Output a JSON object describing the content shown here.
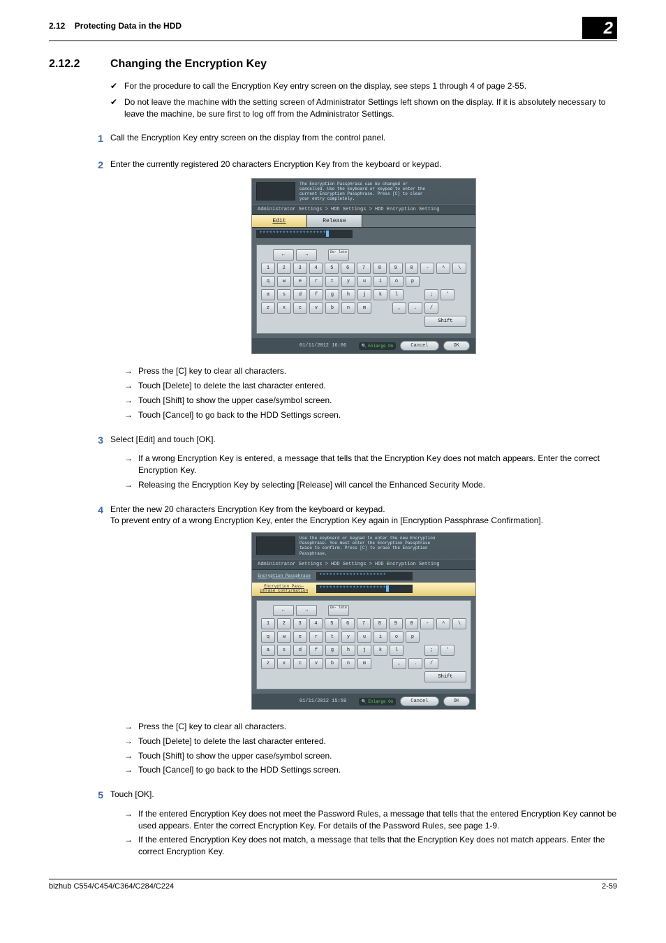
{
  "header": {
    "section_ref": "2.12",
    "section_name": "Protecting Data in the HDD",
    "chapter_badge": "2"
  },
  "section": {
    "number": "2.12.2",
    "title": "Changing the Encryption Key"
  },
  "prereqs": [
    "For the procedure to call the Encryption Key entry screen on the display, see steps 1 through 4 of page 2-55.",
    "Do not leave the machine with the setting screen of Administrator Settings left shown on the display. If it is absolutely necessary to leave the machine, be sure first to log off from the Administrator Settings."
  ],
  "steps": {
    "s1": {
      "num": "1",
      "text": "Call the Encryption Key entry screen on the display from the control panel."
    },
    "s2": {
      "num": "2",
      "text": "Enter the currently registered 20 characters Encryption Key from the keyboard or keypad.",
      "arrows": [
        "Press the [C] key to clear all characters.",
        "Touch [Delete] to delete the last character entered.",
        "Touch [Shift] to show the upper case/symbol screen.",
        "Touch [Cancel] to go back to the HDD Settings screen."
      ]
    },
    "s3": {
      "num": "3",
      "text": "Select [Edit] and touch [OK].",
      "arrows": [
        "If a wrong Encryption Key is entered, a message that tells that the Encryption Key does not match appears. Enter the correct Encryption Key.",
        "Releasing the Encryption Key by selecting [Release] will cancel the Enhanced Security Mode."
      ]
    },
    "s4": {
      "num": "4",
      "text": "Enter the new 20 characters Encryption Key from the keyboard or keypad.",
      "text2": "To prevent entry of a wrong Encryption Key, enter the Encryption Key again in [Encryption Passphrase Confirmation].",
      "arrows": [
        "Press the [C] key to clear all characters.",
        "Touch [Delete] to delete the last character entered.",
        "Touch [Shift] to show the upper case/symbol screen.",
        "Touch [Cancel] to go back to the HDD Settings screen."
      ]
    },
    "s5": {
      "num": "5",
      "text": "Touch [OK].",
      "arrows": [
        "If the entered Encryption Key does not meet the Password Rules, a message that tells that the entered Encryption Key cannot be used appears. Enter the correct Encryption Key. For details of the Password Rules, see page 1-9.",
        "If the entered Encryption Key does not match, a message that tells that the Encryption Key does not match appears. Enter the correct Encryption Key."
      ]
    }
  },
  "screenshot1": {
    "msg": "The Encryption Passphrase can be changed or\ncancelled. Use the keyboard or keypad to enter the\ncurrent Encryption Passphrase. Press [C] to clear\nyour entry completely.",
    "breadcrumb": "Administrator Settings > HDD Settings > HDD Encryption Setting",
    "tab_edit": "Edit",
    "tab_release": "Release",
    "input_value": "********************",
    "delete_label": "De-\nlete",
    "shift_label": "Shift",
    "datetime": "01/11/2012   16:06",
    "enlarge": "Enlarge\nOn",
    "cancel": "Cancel",
    "ok": "OK",
    "rows": {
      "nav": [
        "←",
        "→"
      ],
      "r1": [
        "1",
        "2",
        "3",
        "4",
        "5",
        "6",
        "7",
        "8",
        "9",
        "0",
        "-",
        "^",
        "\\"
      ],
      "r2": [
        "q",
        "w",
        "e",
        "r",
        "t",
        "y",
        "u",
        "i",
        "o",
        "p"
      ],
      "r3": [
        "a",
        "s",
        "d",
        "f",
        "g",
        "h",
        "j",
        "k",
        "l",
        ";",
        "'"
      ],
      "r4": [
        "z",
        "x",
        "c",
        "v",
        "b",
        "n",
        "m",
        ",",
        ".",
        "/"
      ]
    }
  },
  "screenshot2": {
    "msg": "Use the keyboard or keypad to enter the new Encryption\nPassphrase. You must enter the Encryption Passphrase\ntwice to confirm. Press [C] to erase the Encryption\nPassphrase.",
    "breadcrumb": "Administrator Settings > HDD Settings > HDD Encryption Setting",
    "label1": "Encryption\nPassphrase",
    "label2": "Encryption Pass-\nphrase Confirmation",
    "input1": "********************",
    "input2": "********************",
    "delete_label": "De-\nlete",
    "shift_label": "Shift",
    "datetime": "01/11/2012   15:59",
    "enlarge": "Enlarge\nOn",
    "cancel": "Cancel",
    "ok": "OK"
  },
  "footer": {
    "left": "bizhub C554/C454/C364/C284/C224",
    "right": "2-59"
  }
}
